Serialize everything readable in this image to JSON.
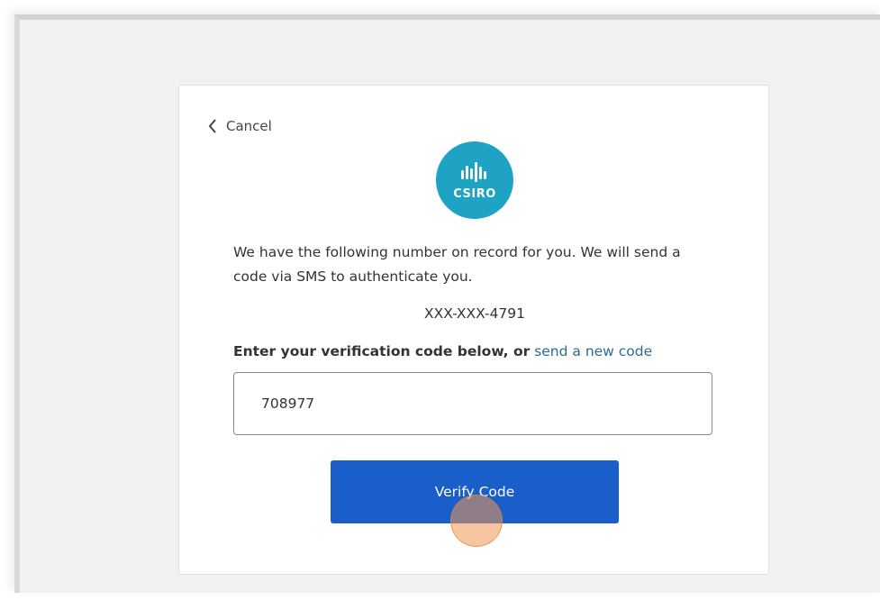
{
  "nav": {
    "cancel_label": "Cancel",
    "back_icon": "chevron-left-icon"
  },
  "logo": {
    "text": "CSIRO",
    "color": "#1ea3c4"
  },
  "message": {
    "intro": "We have the following number on record for you. We will send a code via SMS to authenticate you.",
    "phone_number": "XXX-XXX-4791"
  },
  "verification": {
    "prompt": "Enter your verification code below, or",
    "send_new_code_label": "send a new code",
    "code_value": "708977"
  },
  "actions": {
    "verify_label": "Verify Code",
    "verify_color": "#1a5fc9"
  }
}
